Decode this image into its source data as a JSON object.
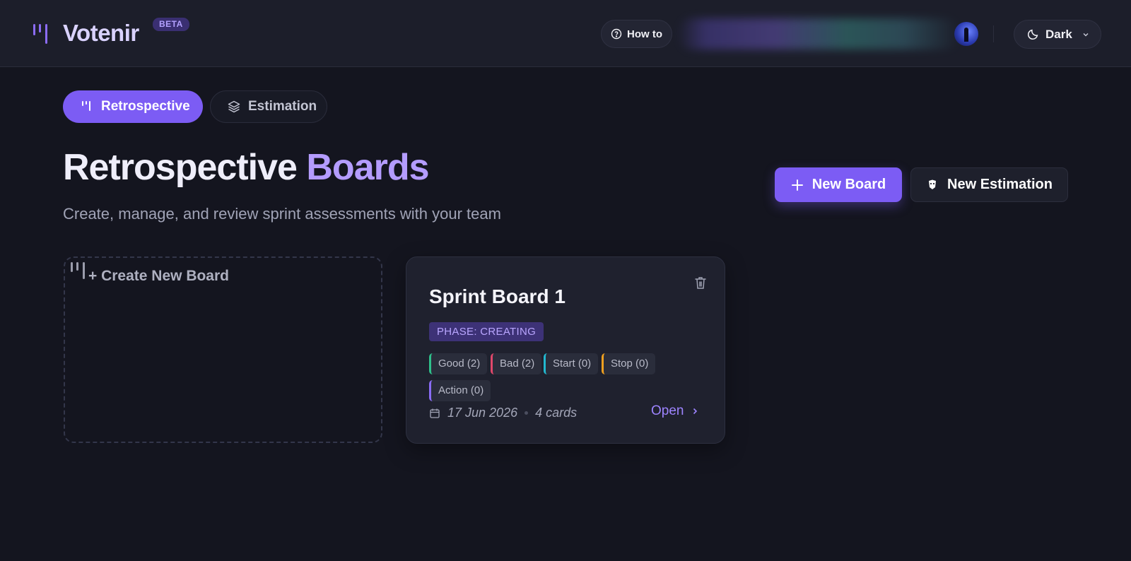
{
  "header": {
    "app_name": "Votenir",
    "badge": "BETA",
    "howto_label": "How to",
    "theme_label": "Dark"
  },
  "tabs": [
    {
      "label": "Retrospective",
      "active": true
    },
    {
      "label": "Estimation",
      "active": false
    }
  ],
  "page": {
    "title_part1": "Retrospective",
    "title_part2": "Boards",
    "subtitle": "Create, manage, and review sprint assessments with your team"
  },
  "actions": {
    "new_board": "New Board",
    "new_estimation": "New Estimation"
  },
  "create_card": {
    "label": "+ Create New Board"
  },
  "boards": [
    {
      "title": "Sprint Board 1",
      "phase": "PHASE: CREATING",
      "categories": [
        {
          "label": "Good (2)",
          "color": "#2fbf8a"
        },
        {
          "label": "Bad (2)",
          "color": "#e0486b"
        },
        {
          "label": "Start (0)",
          "color": "#22b8cf"
        },
        {
          "label": "Stop (0)",
          "color": "#f0a020"
        },
        {
          "label": "Action (0)",
          "color": "#8a6cf5"
        }
      ],
      "date": "17 Jun 2026",
      "cards": "4 cards",
      "open_label": "Open"
    }
  ],
  "colors": {
    "accent": "#7c5cf4",
    "background": "#14151f",
    "header": "#1c1e2a"
  }
}
